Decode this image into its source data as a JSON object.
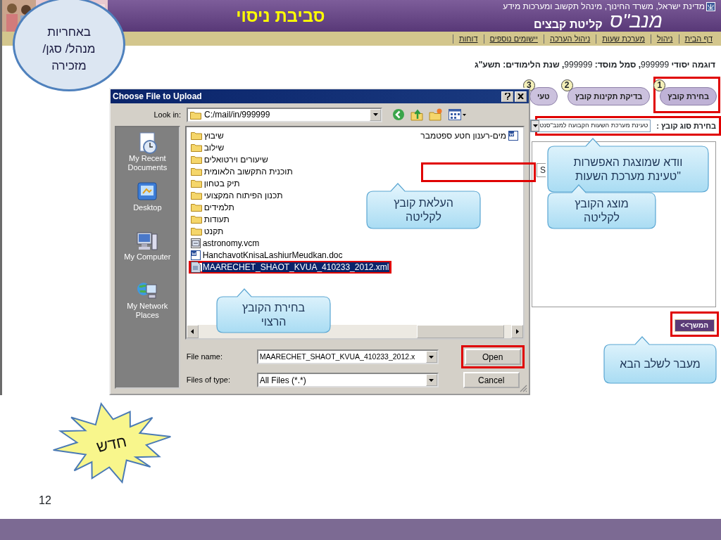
{
  "header": {
    "title": "סביבת ניסוי",
    "ministry": "מדינת ישראל, משרד החינוך, מינהל תקשוב ומערכות מידע",
    "logo": "מנב\"ס",
    "page_title": "קליטת קבצים"
  },
  "nav": [
    {
      "label": "דף הבית"
    },
    {
      "label": "ניהול"
    },
    {
      "label": "מערכת שעות"
    },
    {
      "label": "ניהול הערכה"
    },
    {
      "label": "יישומים נוספים"
    },
    {
      "label": "דוחות"
    }
  ],
  "school_info": "**דוגמה יסודי** 999999**, סמל מוסד:** 999999**, שנת הלימודים: תשע\"ג**",
  "steps": [
    {
      "number": "1",
      "label": "בחירת קובץ",
      "selected": true
    },
    {
      "number": "2",
      "label": "בדיקת תקינות קובץ",
      "selected": false
    },
    {
      "number": "3",
      "label": "טעי",
      "selected": false
    }
  ],
  "file_type": {
    "label": "בחירת סוג קובץ :",
    "value": "טעינת מערכת השעות הקבועה למנב\"סנט",
    "highlighted": true
  },
  "file_field": {
    "value": "S",
    "highlighted": true
  },
  "next_button": {
    "label": "המשך>>",
    "highlighted": true
  },
  "dialog": {
    "title": "Choose File to Upload",
    "look_in_label": "Look in:",
    "look_in": "C:/mail/in/999999",
    "places": [
      {
        "label": "My Recent Documents",
        "kind": "recent"
      },
      {
        "label": "Desktop",
        "kind": "desktop"
      },
      {
        "label": "My Computer",
        "kind": "computer"
      },
      {
        "label": "My Network Places",
        "kind": "network"
      }
    ],
    "files": [
      {
        "name": "שיבוץ",
        "kind": "folder",
        "selected": false
      },
      {
        "name": "שילוב",
        "kind": "folder",
        "selected": false
      },
      {
        "name": "שיעורים וירטואלים",
        "kind": "folder",
        "selected": false
      },
      {
        "name": "תוכנית התקשוב הלאומית",
        "kind": "folder",
        "selected": false
      },
      {
        "name": "תיק בטחון",
        "kind": "folder",
        "selected": false
      },
      {
        "name": "תכנון הפיתוח המקצועי",
        "kind": "folder",
        "selected": false
      },
      {
        "name": "תלמידים",
        "kind": "folder",
        "selected": false
      },
      {
        "name": "תעודות",
        "kind": "folder",
        "selected": false
      },
      {
        "name": "תקנט",
        "kind": "folder",
        "selected": false
      },
      {
        "name": "astronomy.vcm",
        "kind": "vcm",
        "selected": false
      },
      {
        "name": "HanchavotKnisaLashiurMeudkan.doc",
        "kind": "doc",
        "selected": false
      },
      {
        "name": "MAARECHET_SHAOT_KVUA_410233_2012.xml",
        "kind": "xml",
        "selected": true
      }
    ],
    "files_column_2": [
      {
        "name": "מים-רענון חטע ספטמבר",
        "kind": "doc",
        "selected": false
      }
    ],
    "file_name_label": "File name:",
    "file_name": "MAARECHET_SHAOT_KVUA_410233_2012.x",
    "file_type_label": "Files of type:",
    "file_type": "All Files (*.*)",
    "open_button": {
      "label": "Open",
      "highlighted": true
    },
    "cancel_button": {
      "label": "Cancel"
    }
  },
  "callouts": [
    {
      "text": "וודא שמוצגת האפשרות \"טעינת מערכת השעות"
    },
    {
      "text": "מוצג הקובץ לקליטה"
    },
    {
      "text": "העלאת קובץ לקליטה"
    },
    {
      "text": "בחירת הקובץ הרצוי"
    },
    {
      "text": "מעבר לשלב הבא"
    }
  ],
  "role_note": "באחריות מנהל/ סגן/ מזכירה",
  "new_badge": "חדש",
  "slide_number": "12"
}
